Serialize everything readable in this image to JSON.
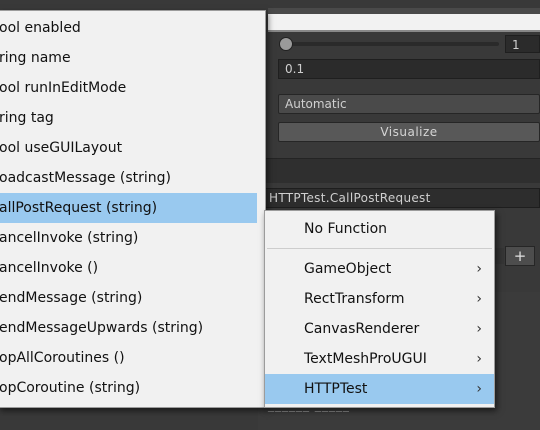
{
  "inspector": {
    "int_value": "1",
    "float_value": "0.1",
    "update_mode": "Automatic",
    "visualize_label": "Visualize",
    "selected_method": "HTTPTest.CallPostRequest",
    "add_label": "+",
    "bottom_text": "______ _____"
  },
  "menu": {
    "items": [
      {
        "label": "ool enabled"
      },
      {
        "label": "ring name"
      },
      {
        "label": "ool runInEditMode"
      },
      {
        "label": "ring tag"
      },
      {
        "label": "ool useGUILayout"
      },
      {
        "label": "oadcastMessage (string)"
      },
      {
        "label": "allPostRequest (string)"
      },
      {
        "label": "ancelInvoke (string)"
      },
      {
        "label": "ancelInvoke ()"
      },
      {
        "label": "endMessage (string)"
      },
      {
        "label": "endMessageUpwards (string)"
      },
      {
        "label": "opAllCoroutines ()"
      },
      {
        "label": "opCoroutine (string)"
      }
    ],
    "selected_index": 6
  },
  "submenu": {
    "items": [
      {
        "label": "No Function",
        "arrow": ""
      },
      {
        "label": "GameObject",
        "arrow": "›"
      },
      {
        "label": "RectTransform",
        "arrow": "›"
      },
      {
        "label": "CanvasRenderer",
        "arrow": "›"
      },
      {
        "label": "TextMeshProUGUI",
        "arrow": "›"
      },
      {
        "label": "HTTPTest",
        "arrow": "›"
      }
    ],
    "selected_index": 5
  }
}
